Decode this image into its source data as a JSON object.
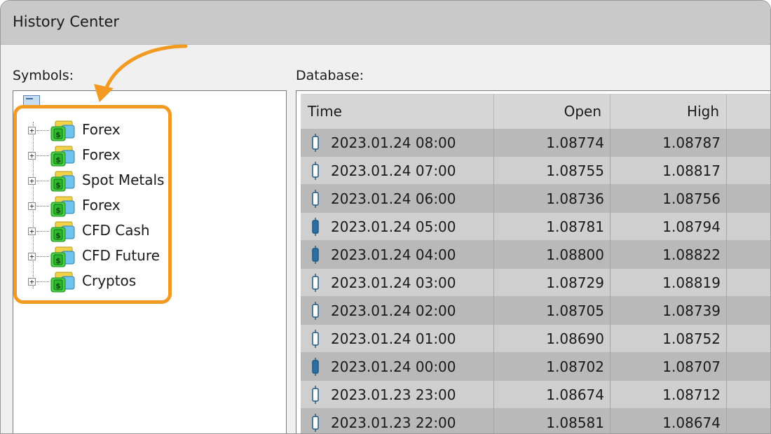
{
  "window": {
    "title": "History Center"
  },
  "symbols": {
    "label": "Symbols:",
    "items": [
      {
        "label": "Forex"
      },
      {
        "label": "Forex"
      },
      {
        "label": "Spot Metals"
      },
      {
        "label": "Forex"
      },
      {
        "label": "CFD Cash"
      },
      {
        "label": "CFD Future"
      },
      {
        "label": "Cryptos"
      }
    ],
    "expander_glyph": "+",
    "item_icon": "folder-dollar-icon",
    "highlight_color": "#f29a21"
  },
  "database": {
    "label": "Database:",
    "columns": {
      "time": "Time",
      "open": "Open",
      "high": "High"
    },
    "rows": [
      {
        "time": "2023.01.24 08:00",
        "open": "1.08774",
        "high": "1.08787",
        "candle": "bullish"
      },
      {
        "time": "2023.01.24 07:00",
        "open": "1.08755",
        "high": "1.08817",
        "candle": "bullish"
      },
      {
        "time": "2023.01.24 06:00",
        "open": "1.08736",
        "high": "1.08756",
        "candle": "bullish"
      },
      {
        "time": "2023.01.24 05:00",
        "open": "1.08781",
        "high": "1.08794",
        "candle": "bearish"
      },
      {
        "time": "2023.01.24 04:00",
        "open": "1.08800",
        "high": "1.08822",
        "candle": "bearish"
      },
      {
        "time": "2023.01.24 03:00",
        "open": "1.08729",
        "high": "1.08819",
        "candle": "bullish"
      },
      {
        "time": "2023.01.24 02:00",
        "open": "1.08705",
        "high": "1.08739",
        "candle": "bullish"
      },
      {
        "time": "2023.01.24 01:00",
        "open": "1.08690",
        "high": "1.08752",
        "candle": "bullish"
      },
      {
        "time": "2023.01.24 00:00",
        "open": "1.08702",
        "high": "1.08707",
        "candle": "bearish"
      },
      {
        "time": "2023.01.23 23:00",
        "open": "1.08674",
        "high": "1.08712",
        "candle": "bullish"
      },
      {
        "time": "2023.01.23 22:00",
        "open": "1.08581",
        "high": "1.08674",
        "candle": "bullish"
      }
    ],
    "candle_colors": {
      "outline": "#1f5a86",
      "bearish_fill": "#2b6fa3",
      "bullish_fill": "#ffffff"
    }
  }
}
